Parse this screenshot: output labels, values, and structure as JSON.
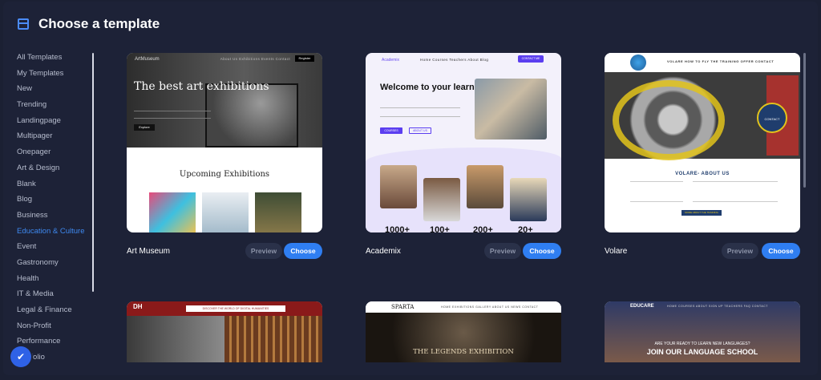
{
  "header": {
    "title": "Choose a template",
    "icon": "layout-icon"
  },
  "sidebar": {
    "items": [
      {
        "label": "All Templates",
        "active": false
      },
      {
        "label": "My Templates",
        "active": false
      },
      {
        "label": "New",
        "active": false
      },
      {
        "label": "Trending",
        "active": false
      },
      {
        "label": "Landingpage",
        "active": false
      },
      {
        "label": "Multipager",
        "active": false
      },
      {
        "label": "Onepager",
        "active": false
      },
      {
        "label": "Art & Design",
        "active": false
      },
      {
        "label": "Blank",
        "active": false
      },
      {
        "label": "Blog",
        "active": false
      },
      {
        "label": "Business",
        "active": false
      },
      {
        "label": "Education & Culture",
        "active": true
      },
      {
        "label": "Event",
        "active": false
      },
      {
        "label": "Gastronomy",
        "active": false
      },
      {
        "label": "Health",
        "active": false
      },
      {
        "label": "IT & Media",
        "active": false
      },
      {
        "label": "Legal & Finance",
        "active": false
      },
      {
        "label": "Non-Profit",
        "active": false
      },
      {
        "label": "Performance",
        "active": false
      },
      {
        "label": "Portfolio",
        "active": false
      }
    ],
    "accent_color": "#3e89f0"
  },
  "buttons": {
    "preview": "Preview",
    "choose": "Choose"
  },
  "templates": [
    {
      "name": "Art Museum",
      "thumb": {
        "logo": "ArtMuseum",
        "nav": "About Us   Exhibitions   Events   Contact",
        "nav_button": "Register",
        "headline": "The best art exhibitions",
        "button": "Explore",
        "section": "Upcoming Exhibitions"
      }
    },
    {
      "name": "Academix",
      "thumb": {
        "logo": "Academix",
        "nav": "Home   Courses   Teachers   About   Blog",
        "nav_button": "CONTACT ME",
        "headline": "Welcome to your learning hub",
        "button1": "COURSES",
        "button2": "ABOUT US",
        "stats": [
          "1000+",
          "100+",
          "200+",
          "20+"
        ]
      }
    },
    {
      "name": "Volare",
      "thumb": {
        "nav": "VOLARE   HOW TO FLY   THE TRAINING   OFFER   CONTACT",
        "circle": "CONTACT",
        "heading": "VOLARE- ABOUT US",
        "button": "MORE ABOUT THE TRAINING"
      }
    },
    {
      "name": "",
      "thumb": {
        "logo": "DH",
        "banner": "DISCOVER THE WORLD OF DIGITAL HUMANITIES"
      }
    },
    {
      "name": "",
      "thumb": {
        "logo": "SPARTA",
        "nav": "HOME   EXHIBITIONS   GALLERY   ABOUT US   NEWS   CONTACT",
        "headline": "THE LEGENDS EXHIBITION"
      }
    },
    {
      "name": "",
      "thumb": {
        "logo": "EDUCARE",
        "nav": "HOME   COURSES   ABOUT   SIGN UP   TEACHERS   FAQ   CONTACT",
        "sub": "ARE YOUR READY TO LEARN NEW LANGUAGES?",
        "headline": "JOIN OUR LANGUAGE SCHOOL"
      }
    }
  ],
  "colors": {
    "background": "#1d2237",
    "primary_button": "#2f7ef1",
    "secondary_button": "#2a3149"
  },
  "floating": {
    "icon": "shield-check-icon"
  }
}
